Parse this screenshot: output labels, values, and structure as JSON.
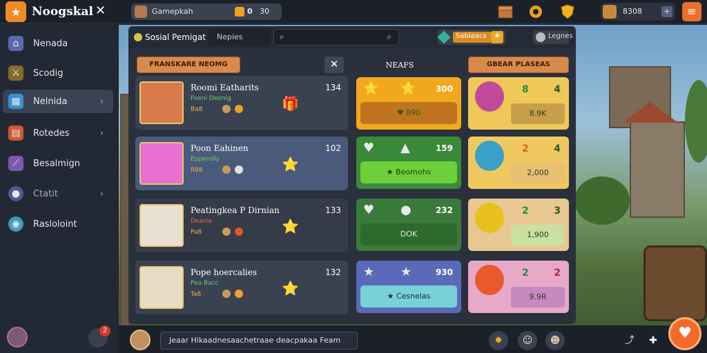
{
  "app": {
    "title": "Noogskal",
    "logo_glyph": "★",
    "close_glyph": "✕"
  },
  "topbar": {
    "player_name": "Gamepkah",
    "coin_value": "0",
    "coin_value2": "30",
    "gem_value": "8308",
    "plus_glyph": "+",
    "menu_glyph": "≡",
    "icons": [
      "chest-icon",
      "gear-icon",
      "shield-icon"
    ]
  },
  "sidebar": {
    "items": [
      {
        "label": "Nenada",
        "icon": "home-icon",
        "chevron": false,
        "active": false
      },
      {
        "label": "Scodig",
        "icon": "sword-icon",
        "chevron": false,
        "active": false
      },
      {
        "label": "Nelnida",
        "icon": "calendar-icon",
        "chevron": true,
        "active": true
      },
      {
        "label": "Rotedes",
        "icon": "book-icon",
        "chevron": true,
        "active": false
      },
      {
        "label": "Besalmign",
        "icon": "wand-icon",
        "chevron": false,
        "active": false
      },
      {
        "label": "Ctatit",
        "icon": "map-pin-icon",
        "chevron": true,
        "active": false
      },
      {
        "label": "Rasloloint",
        "icon": "globe-icon",
        "chevron": false,
        "active": false
      }
    ],
    "notification_count": "2",
    "chevron_glyph": "›"
  },
  "panel": {
    "title": "Sosial Pemigat",
    "tab": "Nepies",
    "search_glyph": "⌕",
    "badge_text": "Sabiaacs",
    "badge_star": "★",
    "right_pill": "Legnes",
    "friends_header": "FRANSKARE NEOMG",
    "close_glyph": "✕",
    "friends": [
      {
        "name": "Roomi Eatharits",
        "status": "Feeni Deonig",
        "level": "Ba8",
        "score": "134",
        "gift": "🎁"
      },
      {
        "name": "Poon Eahinen",
        "status": "Eppendly",
        "level": "R88",
        "score": "102",
        "gift": "⭐"
      },
      {
        "name": "Peatingkea P Dirnian",
        "status": "Deasia",
        "level": "Pa8",
        "score": "133",
        "gift": "⭐"
      },
      {
        "name": "Pope hoercalies",
        "status": "Pea Bacc",
        "level": "Ta8",
        "score": "132",
        "gift": "⭐"
      }
    ],
    "rewards_header": "NEAFS",
    "rewards": [
      {
        "s1": "⭐",
        "s2": "⭐",
        "value": "300",
        "button": "♥ 890",
        "bg": "#f2a81c",
        "btn_bg": "#c07420",
        "btn_color": "#2a5a1a"
      },
      {
        "s1": "♥",
        "s2": "▲",
        "value": "159",
        "button": "★ Beomohs",
        "bg": "#3a8a3a",
        "btn_bg": "#6cd03a",
        "btn_color": "#1e3a10"
      },
      {
        "s1": "♥",
        "s2": "●",
        "value": "232",
        "button": "DOK",
        "bg": "#3a7a3a",
        "btn_bg": "#2e6a2e",
        "btn_color": "#dfe8d8"
      },
      {
        "s1": "★",
        "s2": "★",
        "value": "930",
        "button": "★ Cesnelas",
        "bg": "#5a6ab8",
        "btn_bg": "#7ad0d8",
        "btn_color": "#1a2a3a"
      }
    ],
    "offers_header": "GBEAR PLASEAS",
    "offers": [
      {
        "a": "8",
        "b": "4",
        "price": "8.9K",
        "bg": "#f0c85a",
        "creature": "#c04a9a",
        "price_bg": "#c8a04a"
      },
      {
        "a": "2",
        "b": "4",
        "price": "2,000",
        "bg": "#f0c860",
        "creature": "#3aa0c8",
        "price_bg": "#e8c070"
      },
      {
        "a": "2",
        "b": "3",
        "price": "1,900",
        "bg": "#e8c890",
        "creature": "#e8c020",
        "price_bg": "#c8e0a0"
      },
      {
        "a": "2",
        "b": "2",
        "price": "9.9R",
        "bg": "#e8a8c8",
        "creature": "#e85a2a",
        "price_bg": "#c888c0"
      }
    ]
  },
  "bottombar": {
    "chat_text": "Jeaar Hikaadnesaachetraae deacpakaa Feam",
    "fab_glyph": "♥"
  },
  "colors": {
    "accent": "#f08a24",
    "sidebar": "#222834",
    "panel": "#2a303c"
  }
}
